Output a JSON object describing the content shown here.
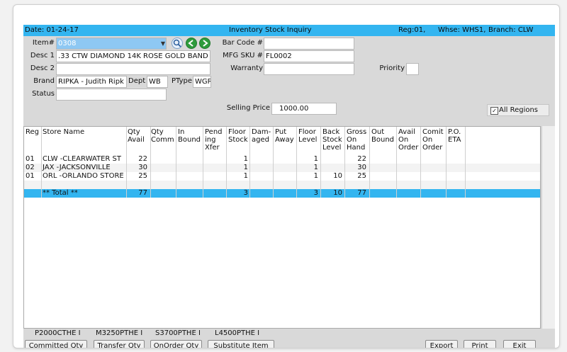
{
  "titlebar": {
    "date": "Date: 01-24-17",
    "title": "Inventory Stock Inquiry",
    "reg": "Reg:01,",
    "whse": "Whse: WHS1,",
    "branch": "Branch: CLW"
  },
  "form": {
    "item_label": "Item#",
    "item_value": "0308",
    "desc1_label": "Desc 1",
    "desc1_value": ".33 CTW DIAMOND 14K ROSE GOLD BAND",
    "desc2_label": "Desc 2",
    "desc2_value": "",
    "brand_label": "Brand",
    "brand_value": "RIPKA - Judith Ripk",
    "dept_label": "Dept",
    "dept_value": "WB",
    "ptype_label": "PType",
    "ptype_value": "WGR",
    "status_label": "Status",
    "status_value": "",
    "barcode_label": "Bar Code #",
    "barcode_value": "",
    "mfgsku_label": "MFG SKU #",
    "mfgsku_value": "FL0002",
    "warranty_label": "Warranty",
    "warranty_value": "",
    "priority_label": "Priority",
    "priority_value": "",
    "selling_price_label": "Selling Price",
    "selling_price_value": "1000.00",
    "all_regions_label": "All Regions",
    "all_regions_checked": "✓"
  },
  "grid": {
    "headers": [
      "Reg",
      "Store Name",
      "Qty\nAvail",
      "Qty\nComm",
      "In\nBound",
      "Pend\ning\nXfer",
      "Floor\nStock",
      "Dam-\naged",
      "Put\nAway",
      "Floor\nLevel",
      "Back\nStock\nLevel",
      "Gross\nOn\nHand",
      "Out\nBound",
      "Avail\nOn\nOrder",
      "Comit\nOn\nOrder",
      "P.O.\nETA"
    ],
    "rows": [
      [
        "01",
        "CLW -CLEARWATER ST",
        "22",
        "",
        "",
        "",
        "1",
        "",
        "",
        "1",
        "",
        "22",
        "",
        "",
        "",
        ""
      ],
      [
        "02",
        "JAX -JACKSONVILLE",
        "30",
        "",
        "",
        "",
        "1",
        "",
        "",
        "1",
        "",
        "30",
        "",
        "",
        "",
        ""
      ],
      [
        "01",
        "ORL -ORLANDO STORE",
        "25",
        "",
        "",
        "",
        "1",
        "",
        "",
        "1",
        "10",
        "25",
        "",
        "",
        "",
        ""
      ]
    ],
    "total": [
      "",
      "** Total **",
      "77",
      "",
      "",
      "",
      "3",
      "",
      "",
      "3",
      "10",
      "77",
      "",
      "",
      "",
      ""
    ]
  },
  "codes": [
    "P2000CTHE I",
    "M3250PTHE I",
    "S3700PTHE I",
    "L4500PTHE I"
  ],
  "buttons": {
    "committed": "Committed Qty",
    "transfer": "Transfer Qty",
    "onorder": "OnOrder Qty",
    "substitute": "Substitute Item",
    "export": "Export",
    "print": "Print",
    "exit": "Exit"
  },
  "colors": {
    "titlebar": "#33b5f0",
    "total_row": "#33b5f0",
    "item_field": "#8ec8f3",
    "panel": "#d9d9d9"
  }
}
